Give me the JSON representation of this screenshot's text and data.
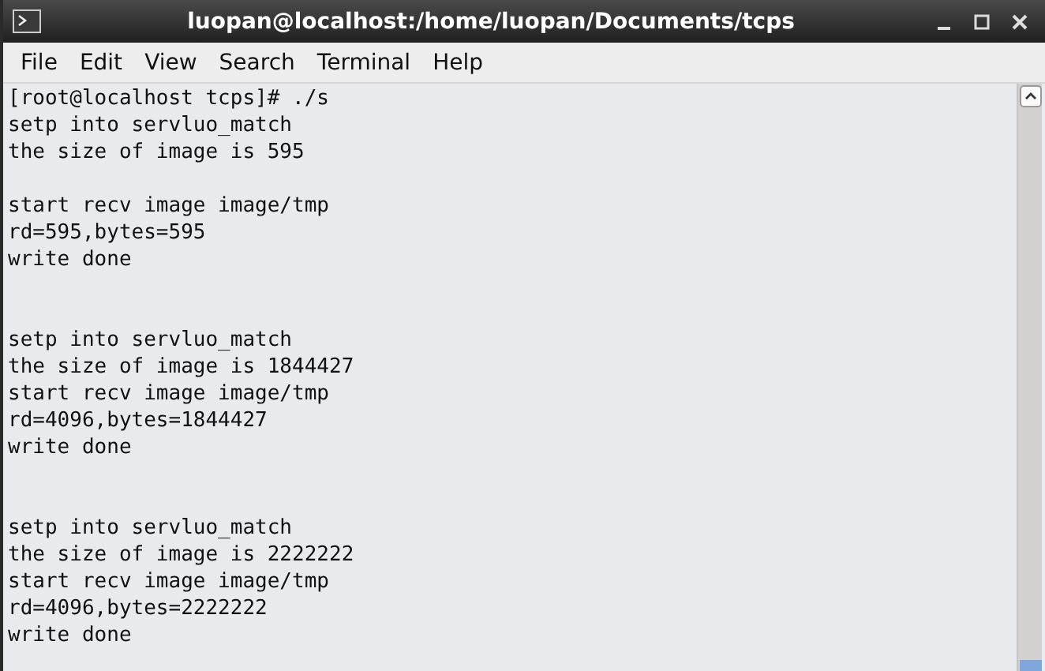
{
  "window": {
    "title": "luopan@localhost:/home/luopan/Documents/tcps"
  },
  "menu": [
    {
      "label": "File"
    },
    {
      "label": "Edit"
    },
    {
      "label": "View"
    },
    {
      "label": "Search"
    },
    {
      "label": "Terminal"
    },
    {
      "label": "Help"
    }
  ],
  "terminal": {
    "lines": [
      {
        "kind": "text",
        "text": "[root@localhost tcps]# ./s"
      },
      {
        "kind": "text",
        "text": "setp into servluo_match"
      },
      {
        "kind": "text",
        "text": "the size of image is 595"
      },
      {
        "kind": "blank"
      },
      {
        "kind": "text",
        "text": "start recv image image/tmp"
      },
      {
        "kind": "text",
        "text": "rd=595,bytes=595"
      },
      {
        "kind": "text",
        "text": "write done"
      },
      {
        "kind": "blank"
      },
      {
        "kind": "blank"
      },
      {
        "kind": "text",
        "text": "setp into servluo_match"
      },
      {
        "kind": "text",
        "text": "the size of image is 1844427"
      },
      {
        "kind": "text",
        "text": "start recv image image/tmp"
      },
      {
        "kind": "text",
        "text": "rd=4096,bytes=1844427"
      },
      {
        "kind": "text",
        "text": "write done"
      },
      {
        "kind": "blank"
      },
      {
        "kind": "blank"
      },
      {
        "kind": "text",
        "text": "setp into servluo_match"
      },
      {
        "kind": "text",
        "text": "the size of image is 2222222"
      },
      {
        "kind": "text",
        "text": "start recv image image/tmp"
      },
      {
        "kind": "text",
        "text": "rd=4096,bytes=2222222"
      },
      {
        "kind": "text",
        "text": "write done"
      }
    ]
  }
}
